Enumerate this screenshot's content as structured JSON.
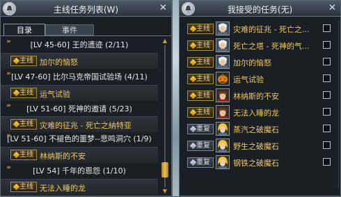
{
  "left_panel": {
    "title": "主线任务列表(W)",
    "close_glyph": "✕",
    "tabs": [
      {
        "label": "目录"
      },
      {
        "label": "事件"
      }
    ],
    "groups": [
      {
        "header": "[LV 45-60] 王的遗迹 (2/11)",
        "quest": {
          "badge": "主线",
          "name": "加尔的恼怒"
        }
      },
      {
        "header": "[LV 47-60] 比尔马克帝国试验场 (4/11)",
        "quest": {
          "badge": "主线",
          "name": "运气试验"
        }
      },
      {
        "header": "[LV 51-60] 死神的邀请 (5/23)",
        "quest": {
          "badge": "主线",
          "name": "灾难的征兆 - 死亡之納特亚"
        }
      },
      {
        "header": "[LV 51-60] 不褪色的噩梦--悲鸣洞穴 (1/9)",
        "quest": {
          "badge": "主线",
          "name": "林纳斯的不安"
        }
      },
      {
        "header": "[LV 54] 千年的恩怨 (1/10)",
        "quest": {
          "badge": "主线",
          "name": "无法入睡的龙"
        }
      }
    ],
    "scroll_up": "▲",
    "scroll_down": "▼"
  },
  "right_panel": {
    "title": "我接受的任务(无)",
    "close_glyph": "✕",
    "quests": [
      {
        "badge": "主线",
        "name": "灾难的征兆 - 死亡之...",
        "portrait": "white-hair-portrait"
      },
      {
        "badge": "主线",
        "name": "死亡之塔 - 死神的气...",
        "portrait": "white-hair-portrait"
      },
      {
        "badge": "主线",
        "name": "加尔的恼怒",
        "portrait": "white-hair-portrait"
      },
      {
        "badge": "主线",
        "name": "运气试验",
        "portrait": "pumpkin-portrait"
      },
      {
        "badge": "主线",
        "name": "林纳斯的不安",
        "portrait": "brown-hair-portrait"
      },
      {
        "badge": "主线",
        "name": "无法入睡的龙",
        "portrait": "brown-hair-portrait"
      },
      {
        "badge": "重复",
        "name": "蒸汽之破魔石",
        "portrait": "blonde-portrait"
      },
      {
        "badge": "重复",
        "name": "野生之破魔石",
        "portrait": "blonde-portrait"
      },
      {
        "badge": "重复",
        "name": "钢铁之破魔石",
        "portrait": "blonde-portrait"
      }
    ]
  },
  "colors": {
    "quest_name": "#f6c75a",
    "panel_bg": "#1a1f25",
    "badge_gold": "#a78a3c"
  }
}
